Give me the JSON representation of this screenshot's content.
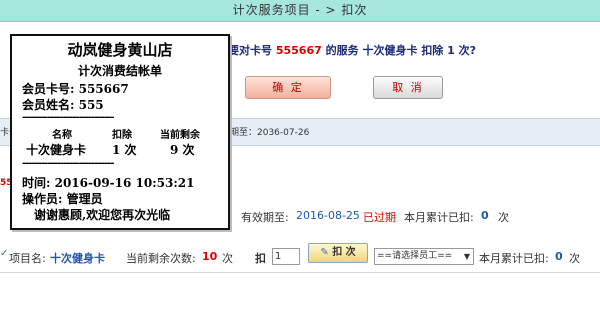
{
  "header": {
    "title": "计次服务项目 - > 扣次"
  },
  "confirm": {
    "prefix": "要对卡号",
    "card_no": "555667",
    "middle": "的服务",
    "service": "十次健身卡",
    "deduct_label": "扣除",
    "count": "1",
    "suffix": "次?",
    "ok_label": "确 定",
    "cancel_label": "取 消"
  },
  "info_band": {
    "left_fragment": "卡号",
    "expiry_fragment": "期至：2036-07-26"
  },
  "side_fragments": {
    "red_fragment": "55"
  },
  "record": {
    "expiry_label": "有效期至:",
    "expiry_value": "2016-08-25",
    "expired_status": "已过期",
    "monthly_label": "本月累计已扣:",
    "monthly_value": "0",
    "unit": "次"
  },
  "deduct_row": {
    "project_label": "项目名:",
    "project_value": "十次健身卡",
    "remaining_label": "当前剩余次数:",
    "remaining_value": "10",
    "unit": "次",
    "deduct_label": "扣",
    "qty_value": "1",
    "deduct_button": "扣 次",
    "employee_select": "==请选择员工==",
    "monthly_label": "本月累计已扣:",
    "monthly_value": "0",
    "unit2": "次"
  },
  "receipt": {
    "store": "动岚健身黄山店",
    "title": "计次消费结帐单",
    "card_line": "会员卡号: 555667",
    "name_line": "会员姓名: 555",
    "divider": "-----------------------------",
    "col_name": "名称",
    "col_deduct": "扣除",
    "col_remaining": "当前剩余",
    "item_name": "十次健身卡",
    "item_deduct": "1 次",
    "item_remaining": "9 次",
    "time_line": "时间: 2016-09-16 10:53:21",
    "operator_line": "操作员: 管理员",
    "thanks": "谢谢惠顾,欢迎您再次光临"
  },
  "colors": {
    "header_bg": "#a6e6dc",
    "accent_red": "#e00000",
    "link_blue": "#1f56b5"
  }
}
